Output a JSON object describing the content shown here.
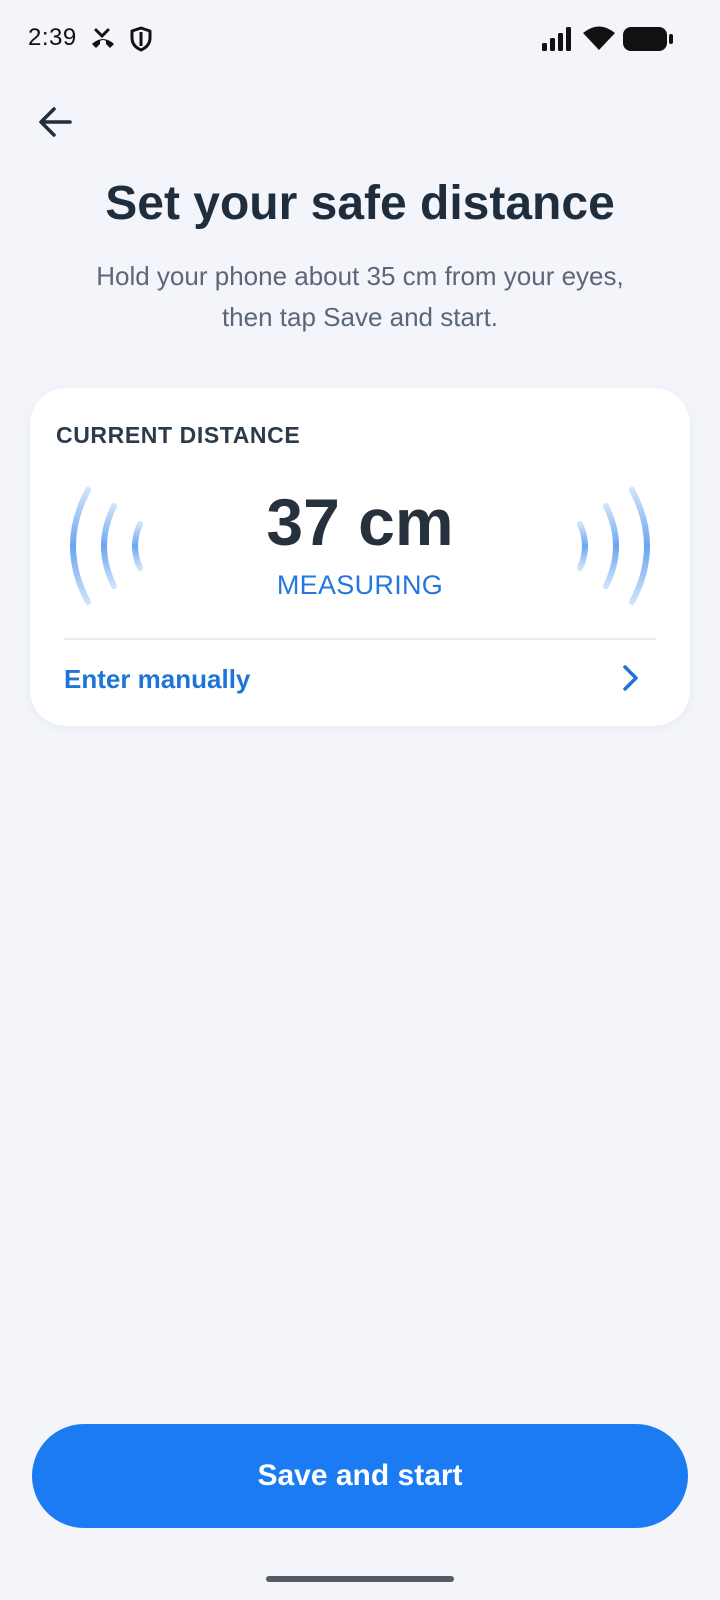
{
  "status_bar": {
    "time": "2:39",
    "icons": [
      "missed-call-icon",
      "shield-icon",
      "signal-icon",
      "wifi-icon",
      "battery-icon"
    ]
  },
  "header": {
    "back_icon": "arrow-left-icon"
  },
  "main": {
    "title": "Set your safe distance",
    "subtitle": "Hold your phone about 35 cm from your eyes, then tap Save and start."
  },
  "card": {
    "label": "CURRENT DISTANCE",
    "distance": "37 cm",
    "status": "MEASURING",
    "manual_label": "Enter manually"
  },
  "footer": {
    "primary_button": "Save and start"
  },
  "colors": {
    "background": "#f3f5fb",
    "accent": "#1b7bf2",
    "link": "#1f74d8",
    "title": "#1f2d3d",
    "wave": "#7fb2f5"
  }
}
